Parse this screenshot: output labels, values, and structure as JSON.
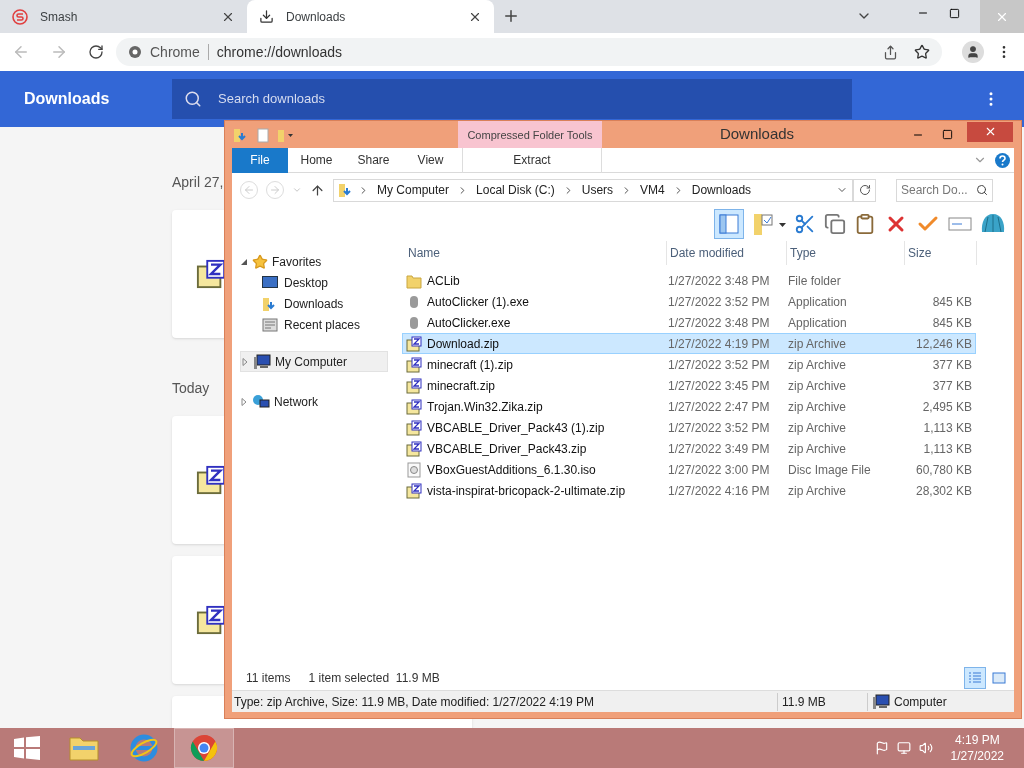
{
  "browser": {
    "tabs": [
      {
        "label": "Smash",
        "kind": "smash",
        "selected": false
      },
      {
        "label": "Downloads",
        "kind": "download",
        "selected": true
      }
    ],
    "omnibox": {
      "site": "Chrome",
      "url": "chrome://downloads"
    },
    "header": {
      "title": "Downloads",
      "search_placeholder": "Search downloads"
    },
    "sections": [
      {
        "date": "April 27,",
        "cards": [
          {
            "kind": "zip"
          }
        ]
      },
      {
        "date": "Today",
        "cards": [
          {
            "kind": "zip"
          },
          {
            "kind": "zip"
          },
          {
            "kind": "blank"
          }
        ]
      }
    ]
  },
  "explorer": {
    "title": "Downloads",
    "context_tab": "Compressed Folder Tools",
    "ribbon_tabs": [
      {
        "label": "File",
        "selected": true
      },
      {
        "label": "Home",
        "selected": false
      },
      {
        "label": "Share",
        "selected": false
      },
      {
        "label": "View",
        "selected": false
      },
      {
        "label": "Extract",
        "selected": false
      }
    ],
    "path": [
      "My Computer",
      "Local Disk (C:)",
      "Users",
      "VM4",
      "Downloads"
    ],
    "search_placeholder": "Search Do...",
    "nav": [
      {
        "label": "Favorites",
        "kind": "star",
        "expanded": true,
        "selected": false,
        "children": [
          {
            "label": "Desktop",
            "kind": "desktop"
          },
          {
            "label": "Downloads",
            "kind": "downloads"
          },
          {
            "label": "Recent places",
            "kind": "recent"
          }
        ]
      },
      {
        "label": "My Computer",
        "kind": "computer",
        "expanded": false,
        "selected": true
      },
      {
        "label": "Network",
        "kind": "network",
        "expanded": false,
        "selected": false
      }
    ],
    "columns": [
      "Name",
      "Date modified",
      "Type",
      "Size"
    ],
    "rows": [
      {
        "name": "ACLib",
        "date": "1/27/2022 3:48 PM",
        "type": "File folder",
        "kind": "folder",
        "selected": false
      },
      {
        "name": "AutoClicker (1).exe",
        "date": "1/27/2022 3:52 PM",
        "type": "Application",
        "size": "845 KB",
        "kind": "exe",
        "selected": false
      },
      {
        "name": "AutoClicker.exe",
        "date": "1/27/2022 3:48 PM",
        "type": "Application",
        "size": "845 KB",
        "kind": "exe",
        "selected": false
      },
      {
        "name": "Download.zip",
        "date": "1/27/2022 4:19 PM",
        "type": "zip Archive",
        "size": "12,246 KB",
        "kind": "zip",
        "selected": true
      },
      {
        "name": "minecraft (1).zip",
        "date": "1/27/2022 3:52 PM",
        "type": "zip Archive",
        "size": "377 KB",
        "kind": "zip",
        "selected": false
      },
      {
        "name": "minecraft.zip",
        "date": "1/27/2022 3:45 PM",
        "type": "zip Archive",
        "size": "377 KB",
        "kind": "zip",
        "selected": false
      },
      {
        "name": "Trojan.Win32.Zika.zip",
        "date": "1/27/2022 2:47 PM",
        "type": "zip Archive",
        "size": "2,495 KB",
        "kind": "zip",
        "selected": false
      },
      {
        "name": "VBCABLE_Driver_Pack43 (1).zip",
        "date": "1/27/2022 3:52 PM",
        "type": "zip Archive",
        "size": "1,113 KB",
        "kind": "zip",
        "selected": false
      },
      {
        "name": "VBCABLE_Driver_Pack43.zip",
        "date": "1/27/2022 3:49 PM",
        "type": "zip Archive",
        "size": "1,113 KB",
        "kind": "zip",
        "selected": false
      },
      {
        "name": "VBoxGuestAdditions_6.1.30.iso",
        "date": "1/27/2022 3:00 PM",
        "type": "Disc Image File",
        "size": "60,780 KB",
        "kind": "iso",
        "selected": false
      },
      {
        "name": "vista-inspirat-bricopack-2-ultimate.zip",
        "date": "1/27/2022 4:16 PM",
        "type": "zip Archive",
        "size": "28,302 KB",
        "kind": "zip",
        "selected": false
      }
    ],
    "status": {
      "count": "11 items",
      "selection": "1 item selected  11.9 MB"
    },
    "views": [
      {
        "kind": "details",
        "selected": true
      },
      {
        "kind": "tiles",
        "selected": false
      }
    ],
    "details_bar": {
      "text": "Type: zip Archive, Size: 11.9 MB, Date modified: 1/27/2022 4:19 PM",
      "size": "11.9 MB",
      "location": "Computer"
    }
  },
  "taskbar": {
    "apps": [
      {
        "kind": "explorer"
      },
      {
        "kind": "ie"
      },
      {
        "kind": "chrome"
      }
    ],
    "time": "4:19 PM",
    "date": "1/27/2022"
  }
}
